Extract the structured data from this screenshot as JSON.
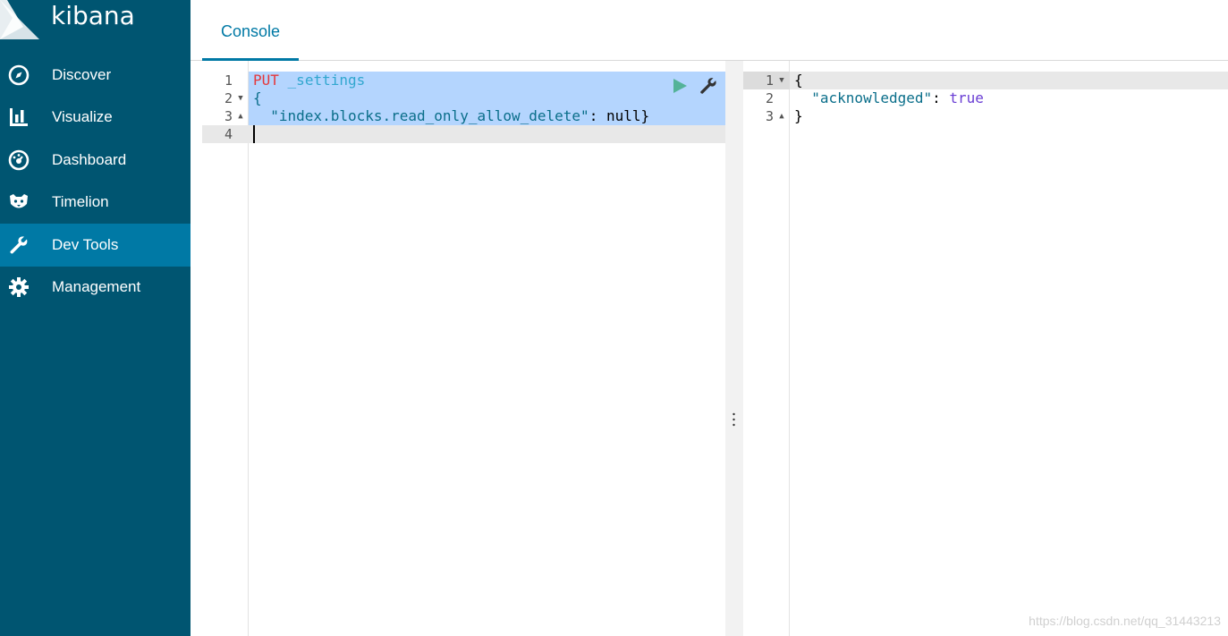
{
  "app": {
    "name": "kibana"
  },
  "sidebar": {
    "items": [
      {
        "label": "Discover",
        "icon": "compass-icon",
        "active": false
      },
      {
        "label": "Visualize",
        "icon": "bar-chart-icon",
        "active": false
      },
      {
        "label": "Dashboard",
        "icon": "gauge-icon",
        "active": false
      },
      {
        "label": "Timelion",
        "icon": "timelion-icon",
        "active": false
      },
      {
        "label": "Dev Tools",
        "icon": "wrench-icon",
        "active": true
      },
      {
        "label": "Management",
        "icon": "gear-icon",
        "active": false
      }
    ]
  },
  "tabs": [
    {
      "label": "Console",
      "active": true
    }
  ],
  "request": {
    "line_numbers": [
      "1",
      "2",
      "3",
      "4"
    ],
    "method": "PUT",
    "url": "_settings",
    "open_brace": "{",
    "key": "\"index.blocks.read_only_allow_delete\"",
    "colon": ": ",
    "value": "null",
    "close_brace": "}"
  },
  "response": {
    "line_numbers": [
      "1",
      "2",
      "3"
    ],
    "open_brace": "{",
    "key": "\"acknowledged\"",
    "colon": ": ",
    "value": "true",
    "close_brace": "}"
  },
  "watermark": "https://blog.csdn.net/qq_31443213",
  "colors": {
    "sidebar_bg": "#005571",
    "sidebar_active": "#0079a5",
    "accent": "#0079a5",
    "method": "#e5383b",
    "url": "#31a7cf",
    "json_key": "#0a6e8a",
    "json_true": "#6a3ed4",
    "selection": "#b4d5fe",
    "run_button": "#54b399"
  }
}
